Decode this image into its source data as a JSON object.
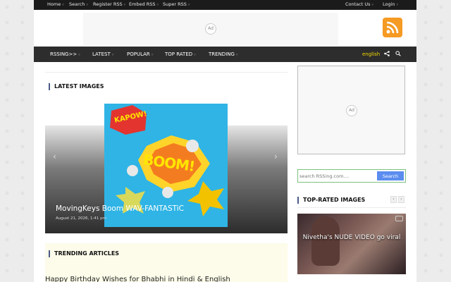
{
  "topbar": {
    "items": [
      "Home",
      "Search",
      "Register RSS",
      "Embed RSS",
      "Super RSS",
      "Contact Us",
      "Login"
    ]
  },
  "header": {
    "ad_label": "Ad"
  },
  "nav": {
    "items": [
      "RSSING>>",
      "LATEST",
      "POPULAR",
      "TOP RATED",
      "TRENDING"
    ],
    "language": "english",
    "share_icon": "share-icon",
    "search_icon": "search-icon"
  },
  "latest": {
    "title": "LATEST IMAGES",
    "slide": {
      "title": "MovingKeys Boom WAV-FANTASTiC",
      "date": "August 21, 2026, 1:41 pm",
      "image_texts": [
        "KAPOW!",
        "BOOM!"
      ]
    }
  },
  "trending": {
    "title": "TRENDING ARTICLES",
    "first_article": "Happy Birthday Wishes for Bhabhi in Hindi & English"
  },
  "sidebar": {
    "ad_label": "Ad",
    "search": {
      "placeholder": "search RSSing.com....",
      "button": "Search"
    },
    "top_rated": {
      "title": "TOP-RATED IMAGES",
      "item_title": "Nivetha's NUDE VIDEO go viral"
    }
  },
  "colors": {
    "topbar_bg": "#1b1b1b",
    "nav_bg": "#2d2d2d",
    "language_color": "#f2d900",
    "rss_orange": "#f59a23",
    "search_button": "#5b8def",
    "slide_bg": "#2fb4e5"
  }
}
